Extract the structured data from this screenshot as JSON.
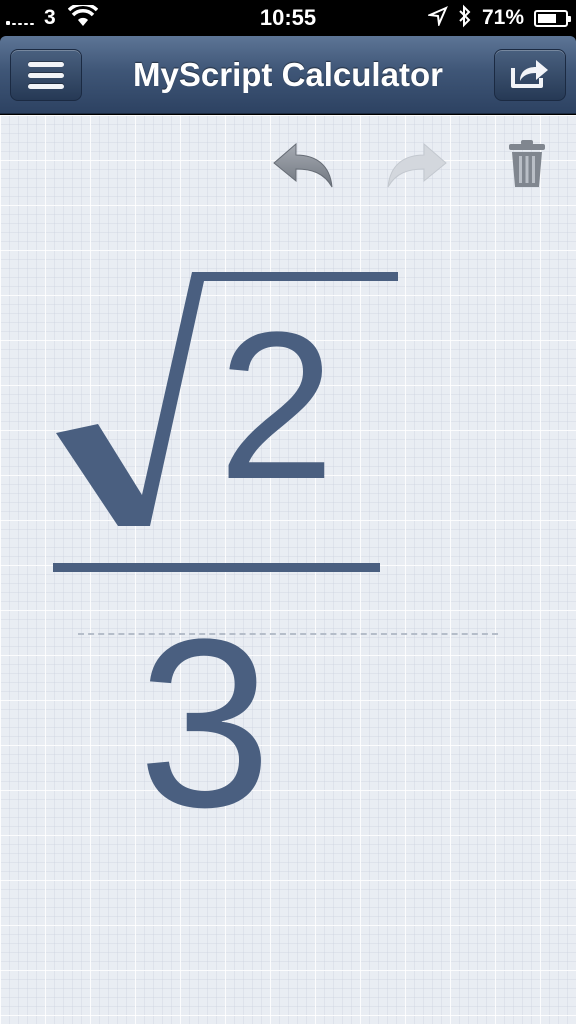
{
  "status_bar": {
    "carrier": "3",
    "time": "10:55",
    "battery_percent": "71%",
    "battery_level": 0.71
  },
  "nav": {
    "title": "MyScript Calculator",
    "menu_icon": "hamburger-menu-icon",
    "share_icon": "share-export-icon"
  },
  "toolbar": {
    "undo_icon": "undo-arrow-icon",
    "redo_icon": "redo-arrow-icon",
    "trash_icon": "trash-can-icon"
  },
  "expression": {
    "numerator": "2",
    "denominator": "3",
    "operator": "square-root"
  },
  "colors": {
    "ink": "#4a5f80",
    "nav_bar": "#3f5677",
    "canvas": "#e9edf3"
  }
}
